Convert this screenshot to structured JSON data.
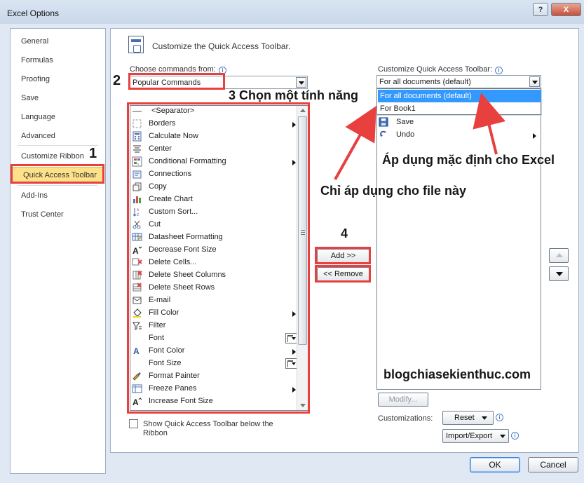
{
  "window": {
    "title": "Excel Options",
    "help_label": "?",
    "close_label": "X"
  },
  "nav": {
    "items": [
      {
        "label": "General"
      },
      {
        "label": "Formulas"
      },
      {
        "label": "Proofing"
      },
      {
        "label": "Save"
      },
      {
        "label": "Language"
      },
      {
        "label": "Advanced"
      },
      {
        "label": "Customize Ribbon"
      },
      {
        "label": "Quick Access Toolbar",
        "selected": true
      },
      {
        "label": "Add-Ins"
      },
      {
        "label": "Trust Center"
      }
    ]
  },
  "main": {
    "header": "Customize the Quick Access Toolbar.",
    "choose_label": "Choose commands from:",
    "choose_value": "Popular Commands",
    "customize_label": "Customize Quick Access Toolbar:",
    "customize_value": "For all documents (default)",
    "commands": [
      {
        "label": "<Separator>",
        "icon": "separator-icon"
      },
      {
        "label": "Borders",
        "icon": "borders-icon",
        "submenu": true
      },
      {
        "label": "Calculate Now",
        "icon": "calculator-icon"
      },
      {
        "label": "Center",
        "icon": "center-align-icon"
      },
      {
        "label": "Conditional Formatting",
        "icon": "conditional-formatting-icon",
        "submenu": true
      },
      {
        "label": "Connections",
        "icon": "connections-icon"
      },
      {
        "label": "Copy",
        "icon": "copy-icon"
      },
      {
        "label": "Create Chart",
        "icon": "chart-icon"
      },
      {
        "label": "Custom Sort...",
        "icon": "sort-icon"
      },
      {
        "label": "Cut",
        "icon": "scissors-icon"
      },
      {
        "label": "Datasheet Formatting",
        "icon": "datasheet-formatting-icon"
      },
      {
        "label": "Decrease Font Size",
        "icon": "decrease-font-icon"
      },
      {
        "label": "Delete Cells...",
        "icon": "delete-cells-icon"
      },
      {
        "label": "Delete Sheet Columns",
        "icon": "delete-columns-icon"
      },
      {
        "label": "Delete Sheet Rows",
        "icon": "delete-rows-icon"
      },
      {
        "label": "E-mail",
        "icon": "email-icon"
      },
      {
        "label": "Fill Color",
        "icon": "fill-color-icon",
        "submenu": true
      },
      {
        "label": "Filter",
        "icon": "filter-icon"
      },
      {
        "label": "Font",
        "icon": "font-icon",
        "split": true
      },
      {
        "label": "Font Color",
        "icon": "font-color-icon",
        "submenu": true
      },
      {
        "label": "Font Size",
        "icon": "font-size-icon",
        "split": true
      },
      {
        "label": "Format Painter",
        "icon": "format-painter-icon"
      },
      {
        "label": "Freeze Panes",
        "icon": "freeze-panes-icon",
        "submenu": true
      },
      {
        "label": "Increase Font Size",
        "icon": "increase-font-icon"
      }
    ],
    "add_button": "Add >>",
    "remove_button": "<< Remove",
    "dropdown_options": [
      {
        "label": "For all documents (default)",
        "selected": true
      },
      {
        "label": "For Book1"
      }
    ],
    "quick_items": [
      {
        "label": "Save",
        "icon": "save-icon"
      },
      {
        "label": "Undo",
        "icon": "undo-icon"
      }
    ],
    "checkbox_label_line1": "Show Quick Access Toolbar below the",
    "checkbox_label_line2": "Ribbon",
    "modify_button": "Modify...",
    "customizations_label": "Customizations:",
    "reset_button": "Reset",
    "import_export_button": "Import/Export"
  },
  "annotations": {
    "one": "1",
    "two": "2",
    "three": "3 Chọn một tính năng",
    "four": "4",
    "default_note": "Áp dụng mặc định cho Excel",
    "file_note": "Chỉ áp dụng cho file này",
    "watermark": "blogchiasekienthuc.com"
  },
  "footer": {
    "ok": "OK",
    "cancel": "Cancel"
  },
  "colors": {
    "highlight_red": "#e83f3f",
    "selected_nav": "#fde289",
    "selected_dropdown": "#3399ff"
  }
}
